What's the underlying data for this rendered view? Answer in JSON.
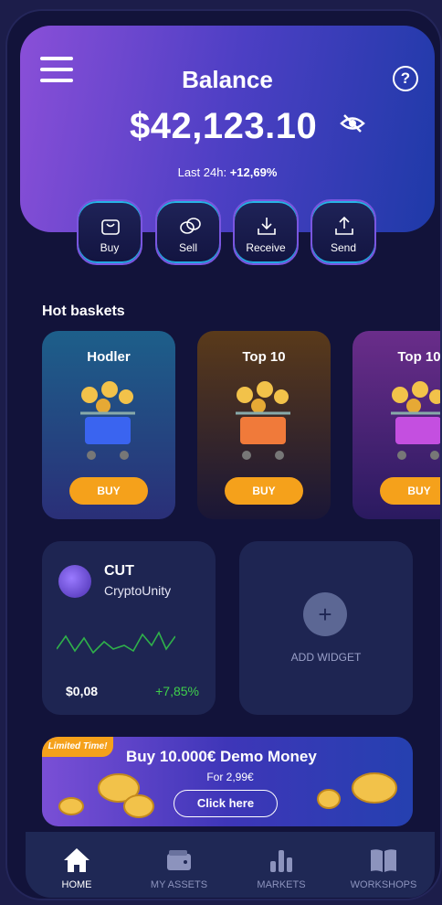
{
  "header": {
    "title": "Balance",
    "amount": "$42,123.10",
    "change_label": "Last 24h:",
    "change_value": "+12,69%"
  },
  "actions": [
    {
      "label": "Buy",
      "icon": "bag-icon"
    },
    {
      "label": "Sell",
      "icon": "coins-icon"
    },
    {
      "label": "Receive",
      "icon": "download-icon"
    },
    {
      "label": "Send",
      "icon": "upload-icon"
    }
  ],
  "hot_baskets": {
    "title": "Hot baskets",
    "items": [
      {
        "name": "Hodler",
        "button": "BUY",
        "color": "#3a64f0"
      },
      {
        "name": "Top 10",
        "button": "BUY",
        "color": "#f07a3a"
      },
      {
        "name": "Top 10",
        "button": "BUY",
        "color": "#c44fe0"
      }
    ]
  },
  "coin_widget": {
    "ticker": "CUT",
    "name": "CryptoUnity",
    "price": "$0,08",
    "change": "+7,85%"
  },
  "add_widget": {
    "label": "ADD WIDGET",
    "symbol": "+"
  },
  "promo": {
    "tag": "Limited Time!",
    "title": "Buy 10.000€ Demo Money",
    "price": "For 2,99€",
    "button": "Click here"
  },
  "nav": [
    {
      "label": "HOME",
      "icon": "home-icon",
      "active": true
    },
    {
      "label": "MY ASSETS",
      "icon": "wallet-icon",
      "active": false
    },
    {
      "label": "MARKETS",
      "icon": "bar-chart-icon",
      "active": false
    },
    {
      "label": "WORKSHOPS",
      "icon": "book-icon",
      "active": false
    }
  ],
  "colors": {
    "accent": "#f5a11b",
    "positive": "#3fd04b",
    "background": "#12133a"
  }
}
